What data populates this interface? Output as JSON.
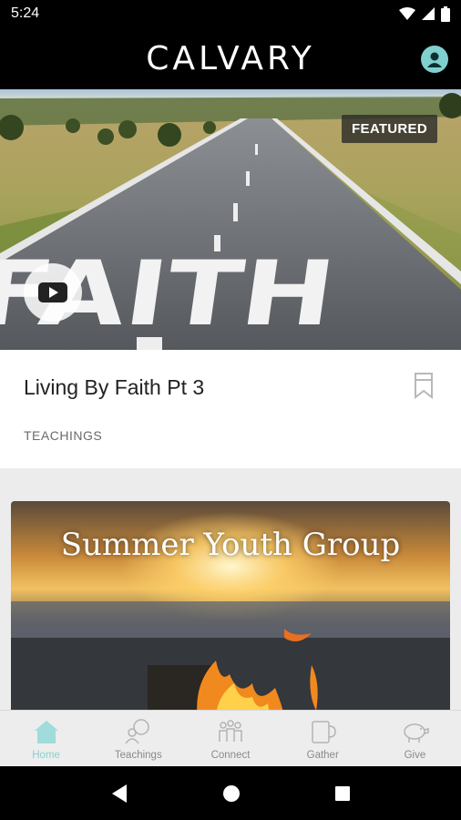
{
  "status_bar": {
    "time": "5:24"
  },
  "app_bar": {
    "title": "CALVARY",
    "profile_icon": "account-circle-icon"
  },
  "featured": {
    "badge": "FEATURED",
    "hero_text": "FAITH",
    "title": "Living By Faith Pt 3",
    "category": "TEACHINGS"
  },
  "event_card": {
    "title": "Summer Youth Group"
  },
  "bottom_nav": {
    "items": [
      {
        "label": "Home",
        "icon": "home-icon",
        "active": true
      },
      {
        "label": "Teachings",
        "icon": "teachings-icon",
        "active": false
      },
      {
        "label": "Connect",
        "icon": "connect-icon",
        "active": false
      },
      {
        "label": "Gather",
        "icon": "gather-icon",
        "active": false
      },
      {
        "label": "Give",
        "icon": "piggy-bank-icon",
        "active": false
      }
    ]
  },
  "colors": {
    "accent": "#7fd0cf",
    "app_bar": "#000000",
    "nav_active": "#86d2d1"
  }
}
